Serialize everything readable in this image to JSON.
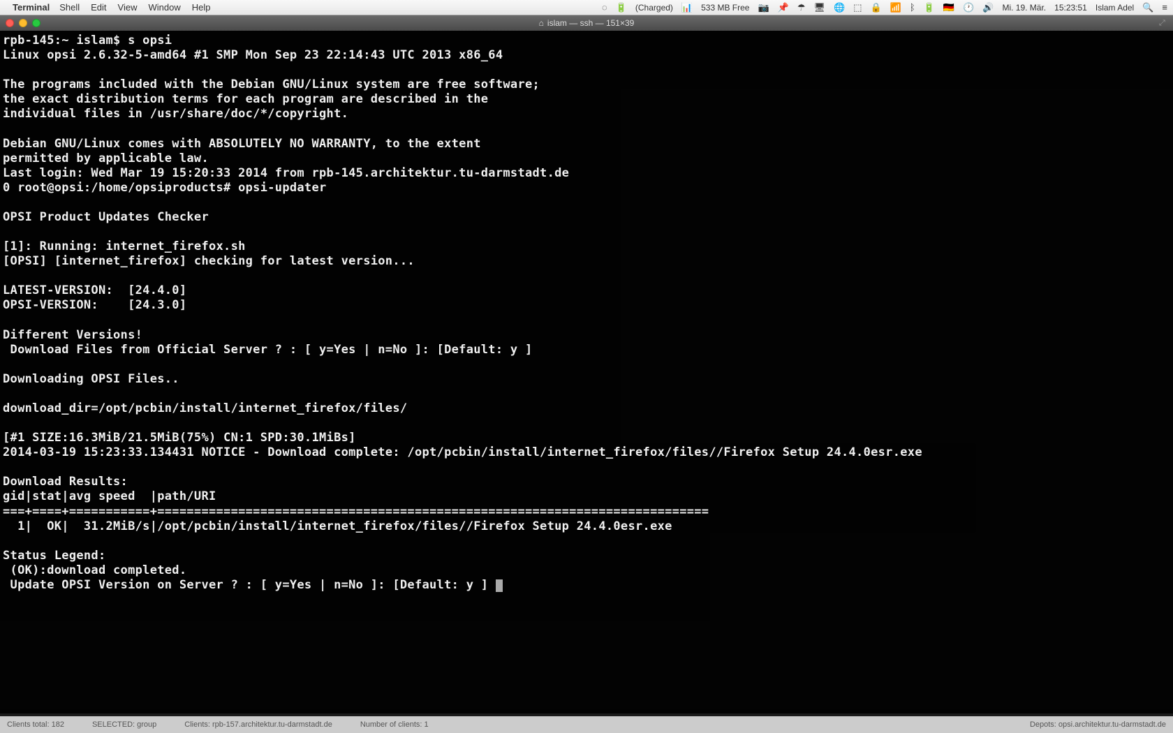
{
  "menubar": {
    "app_name": "Terminal",
    "items": [
      "Shell",
      "Edit",
      "View",
      "Window",
      "Help"
    ],
    "right": {
      "charged": "(Charged)",
      "memory": "533 MB Free",
      "flag": "🇩🇪",
      "date": "Mi. 19. Mär.",
      "time": "15:23:51",
      "user": "Islam Adel"
    }
  },
  "window": {
    "title": "islam — ssh — 151×39"
  },
  "terminal": {
    "lines": [
      "rpb-145:~ islam$ s opsi",
      "Linux opsi 2.6.32-5-amd64 #1 SMP Mon Sep 23 22:14:43 UTC 2013 x86_64",
      "",
      "The programs included with the Debian GNU/Linux system are free software;",
      "the exact distribution terms for each program are described in the",
      "individual files in /usr/share/doc/*/copyright.",
      "",
      "Debian GNU/Linux comes with ABSOLUTELY NO WARRANTY, to the extent",
      "permitted by applicable law.",
      "Last login: Wed Mar 19 15:20:33 2014 from rpb-145.architektur.tu-darmstadt.de",
      "0 root@opsi:/home/opsiproducts# opsi-updater",
      "",
      "OPSI Product Updates Checker",
      "",
      "[1]: Running: internet_firefox.sh",
      "[OPSI] [internet_firefox] checking for latest version...",
      "",
      "LATEST-VERSION:  [24.4.0]",
      "OPSI-VERSION:    [24.3.0]",
      "",
      "Different Versions!",
      " Download Files from Official Server ? : [ y=Yes | n=No ]: [Default: y ]",
      "",
      "Downloading OPSI Files..",
      "",
      "download_dir=/opt/pcbin/install/internet_firefox/files/",
      "",
      "[#1 SIZE:16.3MiB/21.5MiB(75%) CN:1 SPD:30.1MiBs]",
      "2014-03-19 15:23:33.134431 NOTICE - Download complete: /opt/pcbin/install/internet_firefox/files//Firefox Setup 24.4.0esr.exe",
      "",
      "Download Results:",
      "gid|stat|avg speed  |path/URI",
      "===+====+===========+===========================================================================",
      "  1|  OK|  31.2MiB/s|/opt/pcbin/install/internet_firefox/files//Firefox Setup 24.4.0esr.exe",
      "",
      "Status Legend:",
      " (OK):download completed.",
      " Update OPSI Version on Server ? : [ y=Yes | n=No ]: [Default: y ] "
    ]
  },
  "bottom_status": {
    "clients_total": "Clients total: 182",
    "selected": "SELECTED:  group",
    "clients": "Clients:   rpb-157.architektur.tu-darmstadt.de",
    "num_clients": "Number of clients:   1",
    "depots": "Depots:  opsi.architektur.tu-darmstadt.de"
  }
}
